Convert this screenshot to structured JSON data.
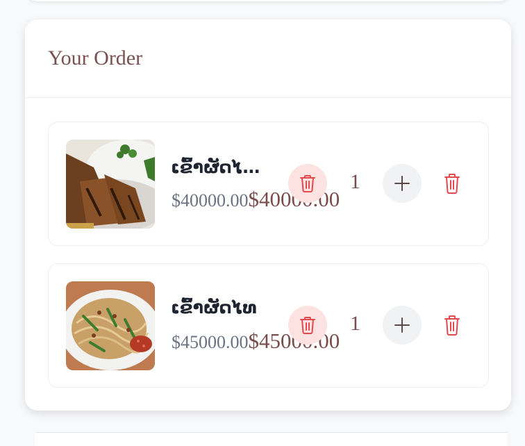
{
  "order": {
    "title": "Your Order",
    "items": [
      {
        "name": "ເຂົ້າຜັດໄ…",
        "unit_price": "$40000.00",
        "total_price": "$40000.00",
        "quantity": "1",
        "image": "grilled-chicken-rice-photo"
      },
      {
        "name": "ເຂົ້າຜັດໄທ",
        "unit_price": "$45000.00",
        "total_price": "$45000.00",
        "quantity": "1",
        "image": "pad-thai-noodles-photo"
      }
    ]
  },
  "icons": {
    "remove": "trash-icon",
    "increase": "plus-icon",
    "delete": "trash-icon"
  },
  "colors": {
    "title": "#7a5050",
    "accent_red": "#e5484d",
    "remove_bg": "#fde2e2",
    "plus_bg": "#f1f2f4"
  }
}
